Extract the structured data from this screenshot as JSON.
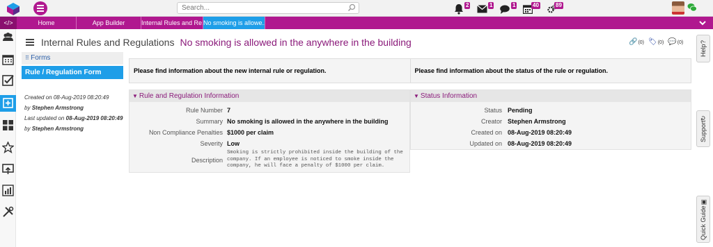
{
  "topbar": {
    "search_placeholder": "Search...",
    "notifications": [
      {
        "icon": "bell-icon",
        "count": "2"
      },
      {
        "icon": "envelope-icon",
        "count": "1"
      },
      {
        "icon": "chat-bubble-icon",
        "count": "1"
      },
      {
        "icon": "calendar-icon",
        "count": "40"
      },
      {
        "icon": "gears-icon",
        "count": "89"
      }
    ]
  },
  "tabs": [
    {
      "label": "Home"
    },
    {
      "label": "App Builder"
    },
    {
      "label": "Internal Rules and Re..."
    },
    {
      "label": "No smoking is allowe..."
    }
  ],
  "colors": {
    "accent": "#b0188f",
    "active": "#1e9ee8"
  },
  "page": {
    "title_main": "Internal Rules and Regulations",
    "title_sub": "No smoking is allowed in the anywhere in the building",
    "counts": {
      "links": "(0)",
      "tags": "(0)",
      "comments": "(0)"
    }
  },
  "forms": {
    "header": "Forms",
    "item": "Rule / Regulation Form"
  },
  "meta": {
    "created_label": "Created on",
    "created_on": "08-Aug-2019 08:20:49",
    "by_label": "by",
    "created_by": "Stephen Armstrong",
    "updated_label": "Last updated on",
    "updated_on": "08-Aug-2019 08:20:49",
    "updated_by": "Stephen Armstrong"
  },
  "notice": {
    "left": "Please find information about the new internal rule or regulation.",
    "right": "Please find information about the status of the rule or regulation."
  },
  "rule_section": {
    "title": "Rule and Regulation Information",
    "fields": [
      {
        "label": "Rule Number",
        "value": "7"
      },
      {
        "label": "Summary",
        "value": "No smoking is allowed in the anywhere in the building"
      },
      {
        "label": "Non Compliance Penalties",
        "value": "$1000 per claim"
      },
      {
        "label": "Severity",
        "value": "Low"
      },
      {
        "label": "Description",
        "value": "Smoking is strictly prohibited inside the building of the company. If an employee is noticed to smoke inside the company, he will face a penalty of $1000 per claim."
      }
    ]
  },
  "status_section": {
    "title": "Status Information",
    "fields": [
      {
        "label": "Status",
        "value": "Pending"
      },
      {
        "label": "Creator",
        "value": "Stephen Armstrong"
      },
      {
        "label": "Created on",
        "value": "08-Aug-2019 08:20:49"
      },
      {
        "label": "Updated on",
        "value": "08-Aug-2019 08:20:49"
      }
    ]
  },
  "right_tabs": {
    "help": "Help",
    "support": "Support",
    "quick_guide": "Quick Guide"
  }
}
